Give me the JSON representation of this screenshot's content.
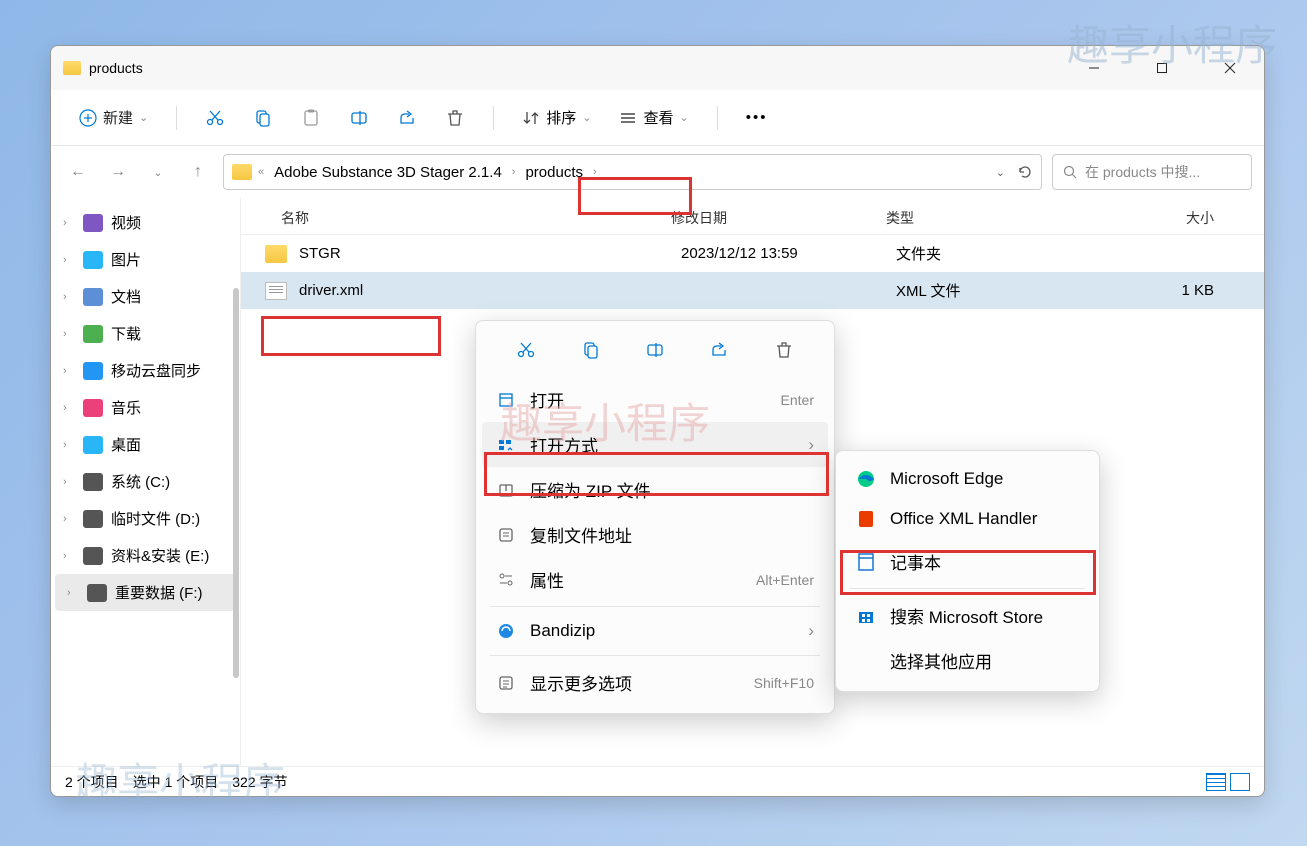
{
  "watermark": "趣享小程序",
  "window": {
    "title": "products"
  },
  "toolbar": {
    "new": "新建",
    "sort": "排序",
    "view": "查看"
  },
  "breadcrumb": {
    "parent": "Adobe Substance 3D Stager 2.1.4",
    "current": "products"
  },
  "search": {
    "placeholder": "在 products 中搜..."
  },
  "sidebar": [
    {
      "label": "视频",
      "color": "#7e57c2"
    },
    {
      "label": "图片",
      "color": "#29b6f6"
    },
    {
      "label": "文档",
      "color": "#5c8fd6"
    },
    {
      "label": "下载",
      "color": "#4caf50"
    },
    {
      "label": "移动云盘同步",
      "color": "#2196f3"
    },
    {
      "label": "音乐",
      "color": "#ec407a"
    },
    {
      "label": "桌面",
      "color": "#29b6f6"
    },
    {
      "label": "系统 (C:)",
      "color": "#555"
    },
    {
      "label": "临时文件 (D:)",
      "color": "#555"
    },
    {
      "label": "资料&安装 (E:)",
      "color": "#555"
    },
    {
      "label": "重要数据 (F:)",
      "color": "#555"
    }
  ],
  "columns": {
    "name": "名称",
    "date": "修改日期",
    "type": "类型",
    "size": "大小"
  },
  "rows": [
    {
      "name": "STGR",
      "date": "2023/12/12 13:59",
      "type": "文件夹",
      "size": "",
      "kind": "folder"
    },
    {
      "name": "driver.xml",
      "date": "",
      "type": "XML 文件",
      "size": "1 KB",
      "kind": "file"
    }
  ],
  "status": {
    "count": "2 个项目",
    "selection": "选中 1 个项目",
    "bytes": "322 字节"
  },
  "context": {
    "open": "打开",
    "open_sc": "Enter",
    "openwith": "打开方式",
    "zip": "压缩为 ZIP 文件",
    "copyaddr": "复制文件地址",
    "props": "属性",
    "props_sc": "Alt+Enter",
    "bandizip": "Bandizip",
    "more": "显示更多选项",
    "more_sc": "Shift+F10"
  },
  "submenu": {
    "edge": "Microsoft Edge",
    "office": "Office XML Handler",
    "notepad": "记事本",
    "store": "搜索 Microsoft Store",
    "other": "选择其他应用"
  }
}
